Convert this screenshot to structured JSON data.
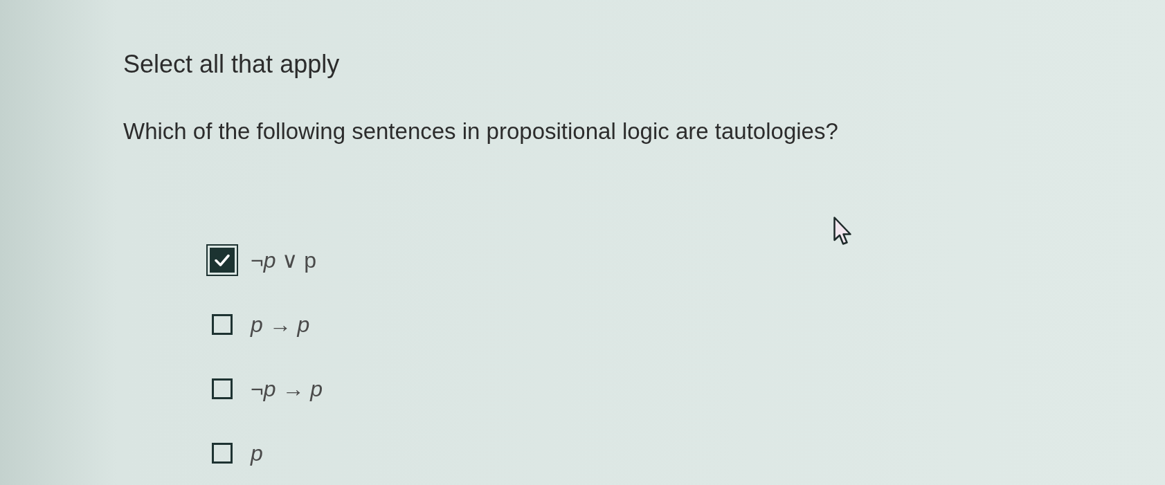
{
  "instruction": "Select all that apply",
  "question": "Which of the following sentences in propositional logic are tautologies?",
  "options": [
    {
      "text": "¬*p* ∨ p",
      "italic": false,
      "checked": true,
      "focused": true
    },
    {
      "text": "p → p",
      "italic": true,
      "checked": false,
      "focused": false
    },
    {
      "text": "¬p → p",
      "italic": true,
      "checked": false,
      "focused": false
    },
    {
      "text": "p",
      "italic": true,
      "checked": false,
      "focused": false
    }
  ]
}
